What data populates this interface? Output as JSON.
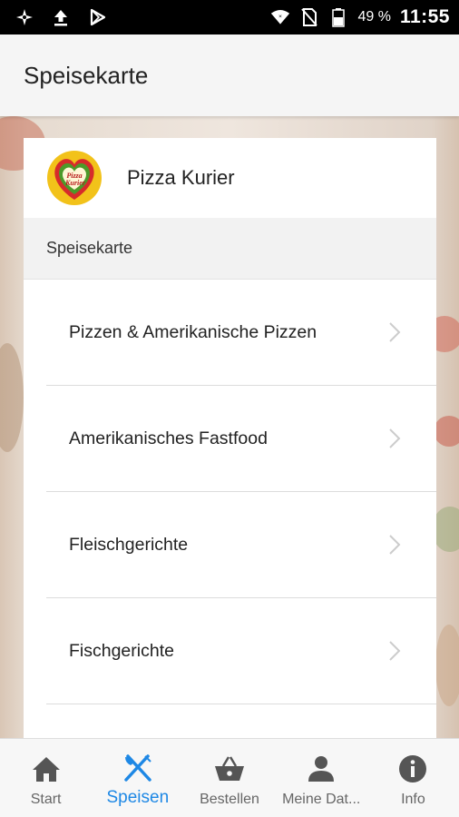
{
  "status_bar": {
    "left_icons": [
      "app-notification-icon",
      "upload-icon",
      "play-store-icon"
    ],
    "right_icons": [
      "wifi-icon",
      "no-sim-icon",
      "battery-icon"
    ],
    "battery_percent": "49 %",
    "time": "11:55"
  },
  "app_bar": {
    "title": "Speisekarte"
  },
  "card": {
    "restaurant_name": "Pizza Kurier",
    "logo_text": [
      "Pizza",
      "Kurier"
    ],
    "section_title": "Speisekarte",
    "items": [
      {
        "label": "Pizzen & Amerikanische Pizzen"
      },
      {
        "label": "Amerikanisches Fastfood"
      },
      {
        "label": "Fleischgerichte"
      },
      {
        "label": "Fischgerichte"
      }
    ]
  },
  "tabs": [
    {
      "label": "Start",
      "icon": "home-icon",
      "active": false
    },
    {
      "label": "Speisen",
      "icon": "fork-knife-icon",
      "active": true
    },
    {
      "label": "Bestellen",
      "icon": "basket-icon",
      "active": false
    },
    {
      "label": "Meine Dat...",
      "icon": "person-icon",
      "active": false
    },
    {
      "label": "Info",
      "icon": "info-icon",
      "active": false
    }
  ],
  "colors": {
    "accent": "#1e88e5",
    "icon_gray": "#555555",
    "chevron": "#cccccc"
  }
}
